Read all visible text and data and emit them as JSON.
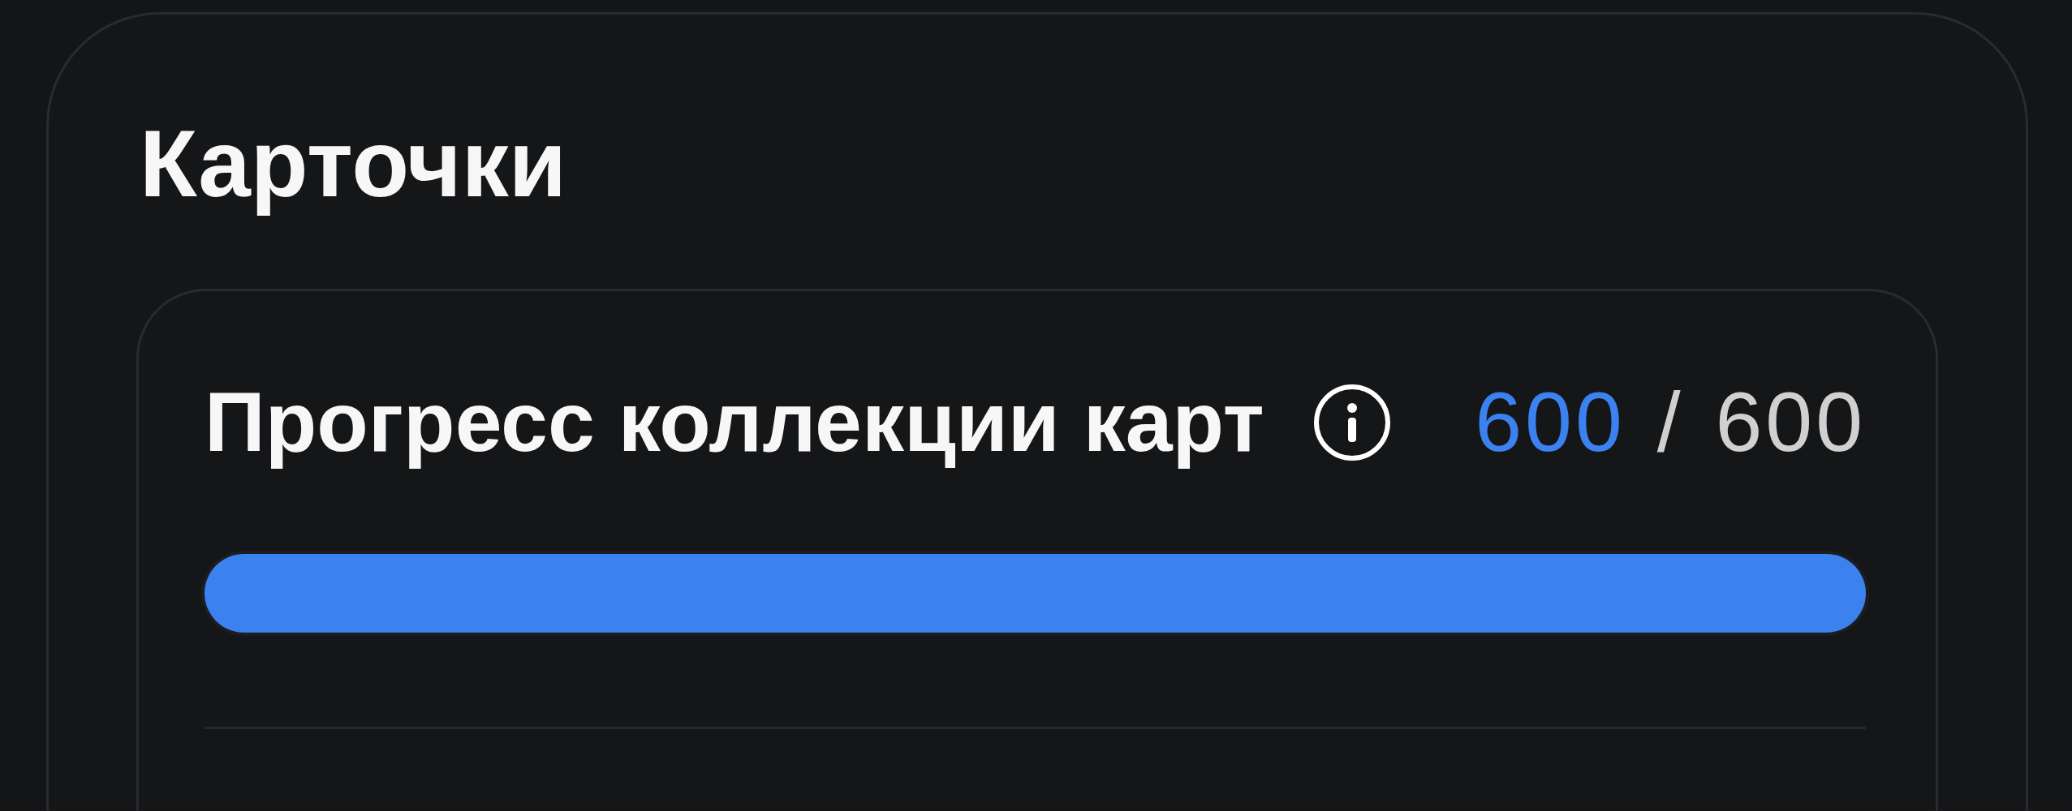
{
  "section": {
    "title": "Карточки"
  },
  "progress_card": {
    "label": "Прогресс коллекции карт",
    "collected": "600",
    "separator": "/",
    "total": "600",
    "level": 1
  }
}
